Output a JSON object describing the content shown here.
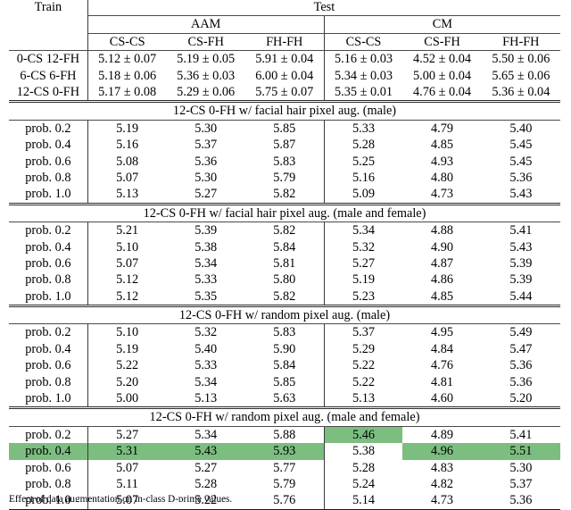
{
  "table": {
    "header": {
      "train_label": "Train",
      "test_label": "Test",
      "group_aam": "AAM",
      "group_cm": "CM",
      "subcols": [
        "CS-CS",
        "CS-FH",
        "FH-FH",
        "CS-CS",
        "CS-FH",
        "FH-FH"
      ]
    },
    "baseline_rows": [
      {
        "label": "0-CS 12-FH",
        "values": [
          "5.12 ± 0.07",
          "5.19 ± 0.05",
          "5.91 ± 0.04",
          "5.16 ± 0.03",
          "4.52 ± 0.04",
          "5.50 ± 0.06"
        ]
      },
      {
        "label": "6-CS 6-FH",
        "values": [
          "5.18 ± 0.06",
          "5.36 ± 0.03",
          "6.00 ± 0.04",
          "5.34 ± 0.03",
          "5.00 ± 0.04",
          "5.65 ± 0.06"
        ]
      },
      {
        "label": "12-CS 0-FH",
        "values": [
          "5.17 ± 0.08",
          "5.29 ± 0.06",
          "5.75 ± 0.07",
          "5.35 ± 0.01",
          "4.76 ± 0.04",
          "5.36 ± 0.04"
        ]
      }
    ],
    "sections": [
      {
        "title": "12-CS 0-FH w/ facial hair pixel aug. (male)",
        "rows": [
          {
            "label": "prob. 0.2",
            "values": [
              "5.19",
              "5.30",
              "5.85",
              "5.33",
              "4.79",
              "5.40"
            ],
            "highlight": [
              false,
              false,
              false,
              false,
              false,
              false
            ]
          },
          {
            "label": "prob. 0.4",
            "values": [
              "5.16",
              "5.37",
              "5.87",
              "5.28",
              "4.85",
              "5.45"
            ],
            "highlight": [
              false,
              false,
              false,
              false,
              false,
              false
            ]
          },
          {
            "label": "prob. 0.6",
            "values": [
              "5.08",
              "5.36",
              "5.83",
              "5.25",
              "4.93",
              "5.45"
            ],
            "highlight": [
              false,
              false,
              false,
              false,
              false,
              false
            ]
          },
          {
            "label": "prob. 0.8",
            "values": [
              "5.07",
              "5.30",
              "5.79",
              "5.16",
              "4.80",
              "5.36"
            ],
            "highlight": [
              false,
              false,
              false,
              false,
              false,
              false
            ]
          },
          {
            "label": "prob. 1.0",
            "values": [
              "5.13",
              "5.27",
              "5.82",
              "5.09",
              "4.73",
              "5.43"
            ],
            "highlight": [
              false,
              false,
              false,
              false,
              false,
              false
            ]
          }
        ],
        "label_highlight": [
          false,
          false,
          false,
          false,
          false
        ]
      },
      {
        "title": "12-CS 0-FH w/ facial hair pixel aug. (male and female)",
        "rows": [
          {
            "label": "prob. 0.2",
            "values": [
              "5.21",
              "5.39",
              "5.82",
              "5.34",
              "4.88",
              "5.41"
            ],
            "highlight": [
              false,
              false,
              false,
              false,
              false,
              false
            ]
          },
          {
            "label": "prob. 0.4",
            "values": [
              "5.10",
              "5.38",
              "5.84",
              "5.32",
              "4.90",
              "5.43"
            ],
            "highlight": [
              false,
              false,
              false,
              false,
              false,
              false
            ]
          },
          {
            "label": "prob. 0.6",
            "values": [
              "5.07",
              "5.34",
              "5.81",
              "5.27",
              "4.87",
              "5.39"
            ],
            "highlight": [
              false,
              false,
              false,
              false,
              false,
              false
            ]
          },
          {
            "label": "prob. 0.8",
            "values": [
              "5.12",
              "5.33",
              "5.80",
              "5.19",
              "4.86",
              "5.39"
            ],
            "highlight": [
              false,
              false,
              false,
              false,
              false,
              false
            ]
          },
          {
            "label": "prob. 1.0",
            "values": [
              "5.12",
              "5.35",
              "5.82",
              "5.23",
              "4.85",
              "5.44"
            ],
            "highlight": [
              false,
              false,
              false,
              false,
              false,
              false
            ]
          }
        ],
        "label_highlight": [
          false,
          false,
          false,
          false,
          false
        ]
      },
      {
        "title": "12-CS 0-FH w/ random pixel aug. (male)",
        "rows": [
          {
            "label": "prob. 0.2",
            "values": [
              "5.10",
              "5.32",
              "5.83",
              "5.37",
              "4.95",
              "5.49"
            ],
            "highlight": [
              false,
              false,
              false,
              false,
              false,
              false
            ]
          },
          {
            "label": "prob. 0.4",
            "values": [
              "5.19",
              "5.40",
              "5.90",
              "5.29",
              "4.84",
              "5.47"
            ],
            "highlight": [
              false,
              false,
              false,
              false,
              false,
              false
            ]
          },
          {
            "label": "prob. 0.6",
            "values": [
              "5.22",
              "5.33",
              "5.84",
              "5.22",
              "4.76",
              "5.36"
            ],
            "highlight": [
              false,
              false,
              false,
              false,
              false,
              false
            ]
          },
          {
            "label": "prob. 0.8",
            "values": [
              "5.20",
              "5.34",
              "5.85",
              "5.22",
              "4.81",
              "5.36"
            ],
            "highlight": [
              false,
              false,
              false,
              false,
              false,
              false
            ]
          },
          {
            "label": "prob. 1.0",
            "values": [
              "5.00",
              "5.13",
              "5.63",
              "5.13",
              "4.60",
              "5.20"
            ],
            "highlight": [
              false,
              false,
              false,
              false,
              false,
              false
            ]
          }
        ],
        "label_highlight": [
          false,
          false,
          false,
          false,
          false
        ]
      },
      {
        "title": "12-CS 0-FH w/ random pixel aug. (male and female)",
        "rows": [
          {
            "label": "prob. 0.2",
            "values": [
              "5.27",
              "5.34",
              "5.88",
              "5.46",
              "4.89",
              "5.41"
            ],
            "highlight": [
              false,
              false,
              false,
              true,
              false,
              false
            ]
          },
          {
            "label": "prob. 0.4",
            "values": [
              "5.31",
              "5.43",
              "5.93",
              "5.38",
              "4.96",
              "5.51"
            ],
            "highlight": [
              true,
              true,
              true,
              false,
              true,
              true
            ]
          },
          {
            "label": "prob. 0.6",
            "values": [
              "5.07",
              "5.27",
              "5.77",
              "5.28",
              "4.83",
              "5.30"
            ],
            "highlight": [
              false,
              false,
              false,
              false,
              false,
              false
            ]
          },
          {
            "label": "prob. 0.8",
            "values": [
              "5.11",
              "5.28",
              "5.79",
              "5.24",
              "4.82",
              "5.37"
            ],
            "highlight": [
              false,
              false,
              false,
              false,
              false,
              false
            ]
          },
          {
            "label": "prob. 1.0",
            "values": [
              "5.07",
              "5.22",
              "5.76",
              "5.14",
              "4.73",
              "5.36"
            ],
            "highlight": [
              false,
              false,
              false,
              false,
              false,
              false
            ]
          }
        ],
        "label_highlight": [
          false,
          true,
          false,
          false,
          false
        ]
      }
    ],
    "highlight_color": "#7cbd80"
  },
  "caption": {
    "text": "Effect of data augmentation on in-class D-prime values."
  }
}
